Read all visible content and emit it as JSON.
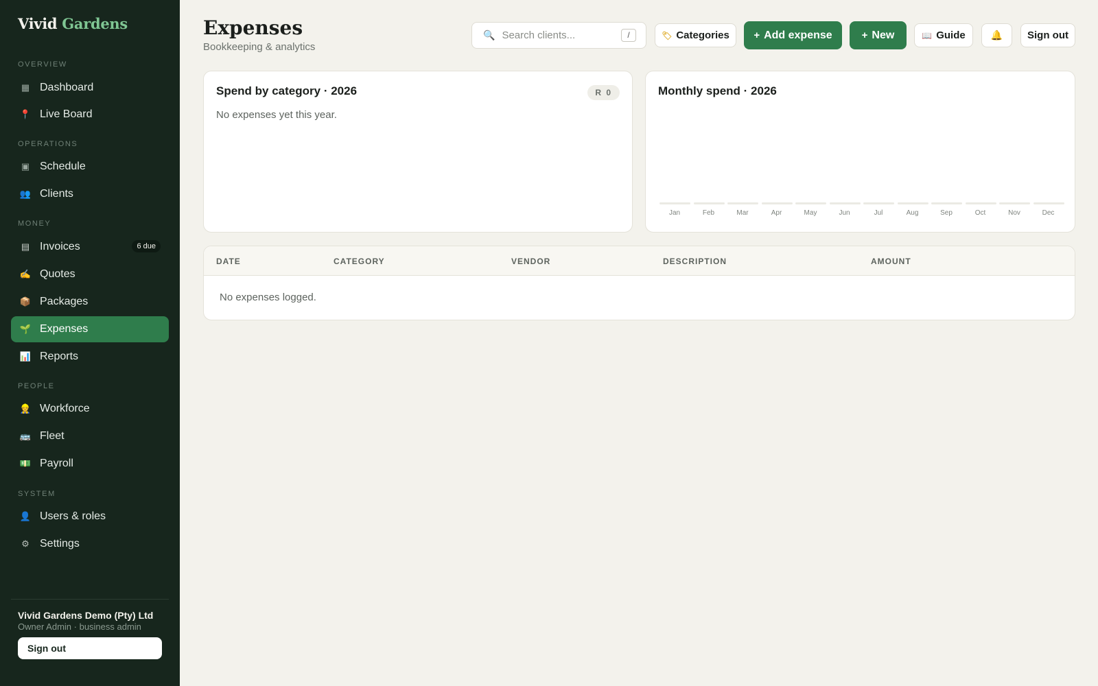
{
  "brand": {
    "part1": "Vivid",
    "part2": "Gardens"
  },
  "sidebar": {
    "sections": [
      {
        "label": "OVERVIEW"
      },
      {
        "label": "OPERATIONS"
      },
      {
        "label": "MONEY"
      },
      {
        "label": "PEOPLE"
      },
      {
        "label": "SYSTEM"
      }
    ],
    "items": [
      {
        "label": "Dashboard",
        "icon": "grid-icon"
      },
      {
        "label": "Live Board",
        "icon": "pin-icon"
      },
      {
        "label": "Schedule",
        "icon": "calendar-icon"
      },
      {
        "label": "Clients",
        "icon": "people-icon"
      },
      {
        "label": "Invoices",
        "icon": "receipt-icon",
        "badge": "6 due"
      },
      {
        "label": "Quotes",
        "icon": "writing-hand-icon"
      },
      {
        "label": "Packages",
        "icon": "package-icon"
      },
      {
        "label": "Expenses",
        "icon": "seedling-icon",
        "active": true
      },
      {
        "label": "Reports",
        "icon": "bar-chart-icon"
      },
      {
        "label": "Workforce",
        "icon": "worker-icon"
      },
      {
        "label": "Fleet",
        "icon": "bus-icon"
      },
      {
        "label": "Payroll",
        "icon": "money-icon"
      },
      {
        "label": "Users & roles",
        "icon": "user-icon"
      },
      {
        "label": "Settings",
        "icon": "gear-icon"
      }
    ],
    "org_name": "Vivid Gardens Demo (Pty) Ltd",
    "org_sub": "Owner Admin · business admin",
    "sign_out": "Sign out"
  },
  "header": {
    "title": "Expenses",
    "subtitle": "Bookkeeping & analytics",
    "search_placeholder": "Search clients...",
    "search_shortcut": "/",
    "categories_label": "Categories",
    "add_expense_label": "Add expense",
    "new_label": "New",
    "guide_label": "Guide",
    "sign_out_label": "Sign out"
  },
  "category_card": {
    "title": "Spend by category · 2026",
    "badge": "R 0",
    "empty": "No expenses yet this year."
  },
  "monthly_card": {
    "title": "Monthly spend · 2026"
  },
  "chart_data": {
    "type": "bar",
    "title": "Monthly spend · 2026",
    "categories": [
      "Jan",
      "Feb",
      "Mar",
      "Apr",
      "May",
      "Jun",
      "Jul",
      "Aug",
      "Sep",
      "Oct",
      "Nov",
      "Dec"
    ],
    "values": [
      0,
      0,
      0,
      0,
      0,
      0,
      0,
      0,
      0,
      0,
      0,
      0
    ],
    "xlabel": "",
    "ylabel": "",
    "grid": false
  },
  "table": {
    "columns": [
      "DATE",
      "CATEGORY",
      "VENDOR",
      "DESCRIPTION",
      "AMOUNT"
    ],
    "rows": [],
    "empty": "No expenses logged."
  },
  "colors": {
    "sidebar_bg": "#17261d",
    "accent": "#2f7d4c",
    "brand_accent": "#7fc693",
    "page_bg": "#f3f2ec"
  }
}
